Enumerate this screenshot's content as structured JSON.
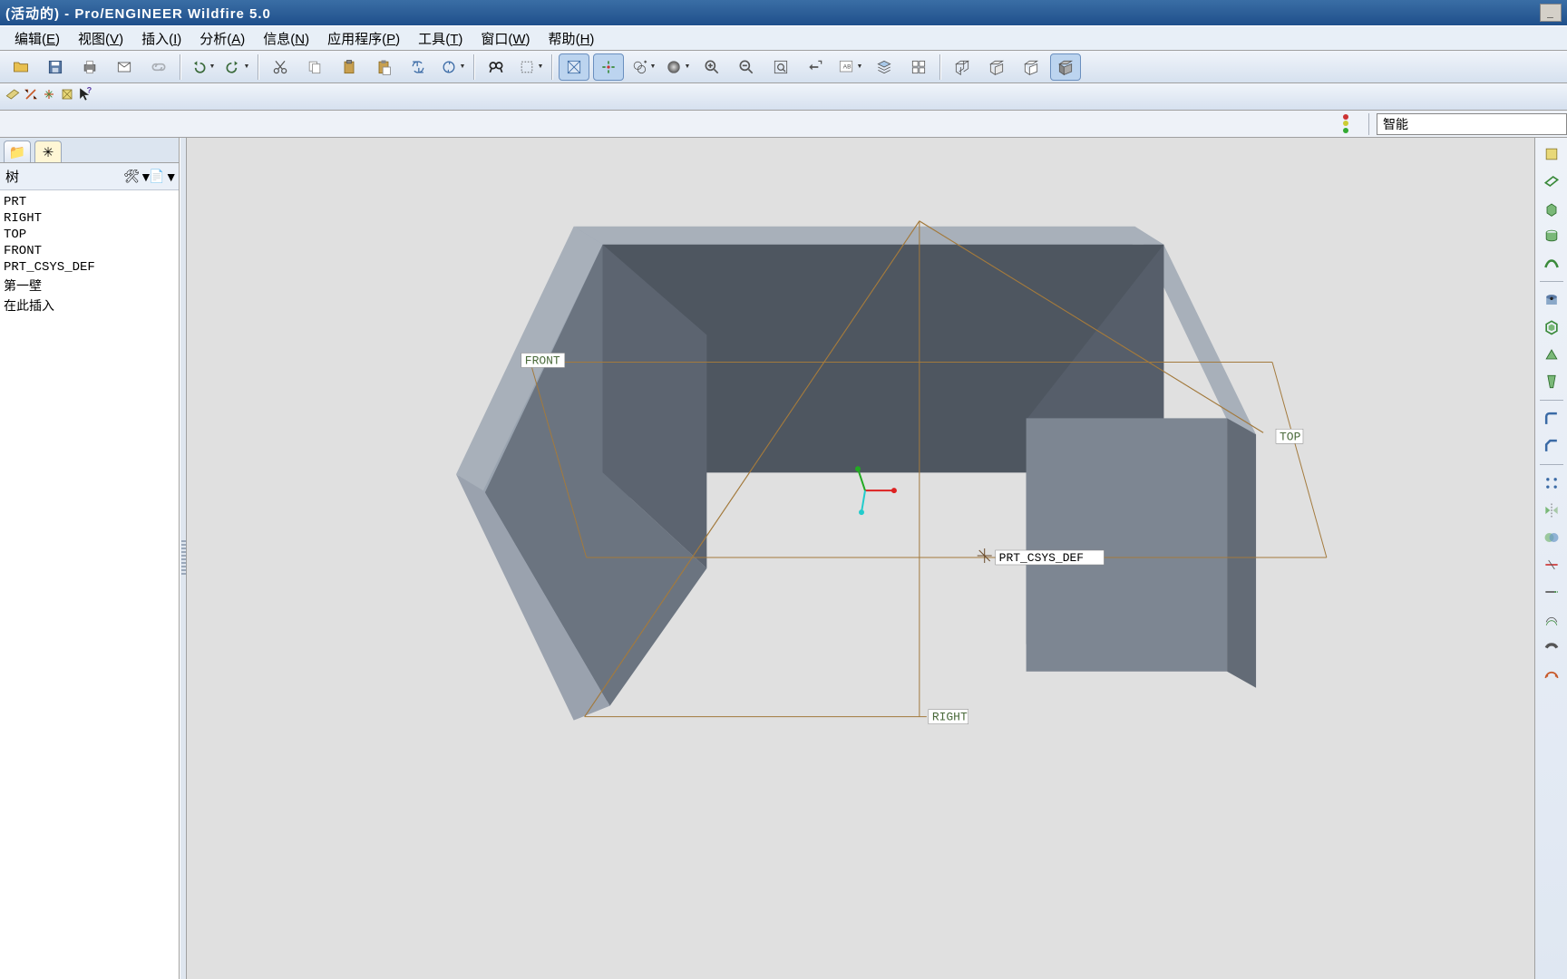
{
  "title": "(活动的) - Pro/ENGINEER Wildfire 5.0",
  "menus": [
    {
      "label": "编辑",
      "accel": "E"
    },
    {
      "label": "视图",
      "accel": "V"
    },
    {
      "label": "插入",
      "accel": "I"
    },
    {
      "label": "分析",
      "accel": "A"
    },
    {
      "label": "信息",
      "accel": "N"
    },
    {
      "label": "应用程序",
      "accel": "P"
    },
    {
      "label": "工具",
      "accel": "T"
    },
    {
      "label": "窗口",
      "accel": "W"
    },
    {
      "label": "帮助",
      "accel": "H"
    }
  ],
  "tree_header": "树",
  "tree_items": [
    "PRT",
    "RIGHT",
    "TOP",
    "FRONT",
    "PRT_CSYS_DEF",
    "第一壁",
    "在此插入"
  ],
  "smart_label": "智能",
  "datum_labels": {
    "front": "FRONT",
    "top": "TOP",
    "right": "RIGHT",
    "csys": "PRT_CSYS_DEF"
  }
}
